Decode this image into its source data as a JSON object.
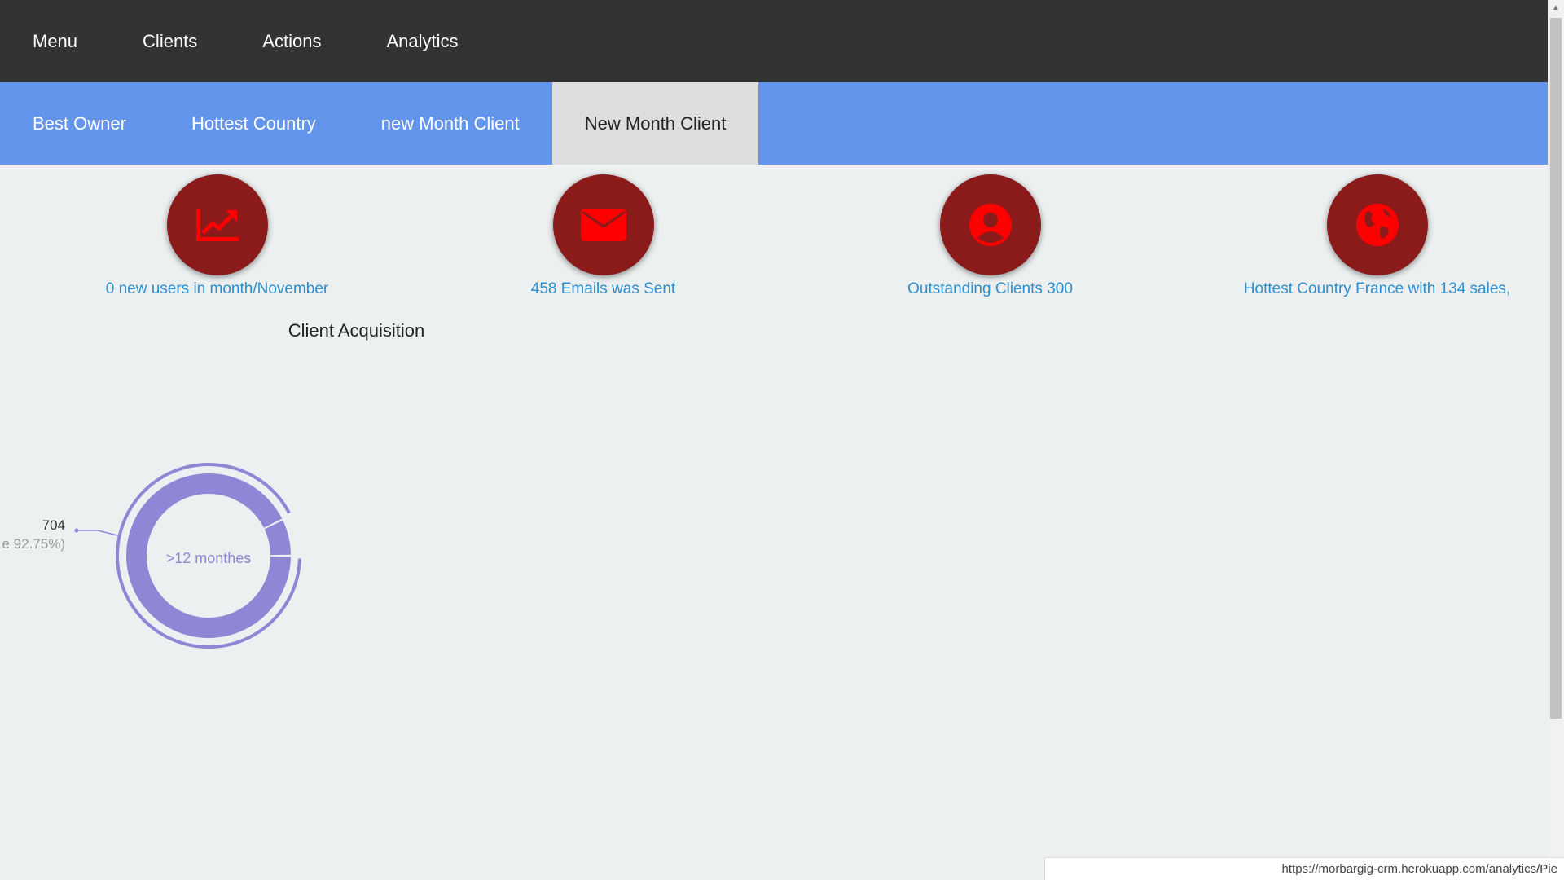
{
  "topnav": {
    "items": [
      {
        "label": "Menu"
      },
      {
        "label": "Clients"
      },
      {
        "label": "Actions"
      },
      {
        "label": "Analytics"
      }
    ]
  },
  "subnav": {
    "items": [
      {
        "label": "Best Owner"
      },
      {
        "label": "Hottest Country"
      },
      {
        "label": "new Month Client"
      },
      {
        "label": "New Month Client",
        "active": true
      }
    ]
  },
  "stats": [
    {
      "icon": "trending-up-icon",
      "caption": "0 new users in month/November"
    },
    {
      "icon": "envelope-icon",
      "caption": "458 Emails was Sent"
    },
    {
      "icon": "user-circle-icon",
      "caption": "Outstanding Clients 300"
    },
    {
      "icon": "globe-icon",
      "caption": "Hottest Country France with 134 sales,"
    }
  ],
  "colors": {
    "topnav_bg": "#333333",
    "subnav_bg": "#6495ed",
    "active_tab_bg": "#dddddd",
    "stat_circle": "#8b1a1a",
    "stat_icon": "#ff0000",
    "caption_text": "#2a8fd0",
    "donut": "#8f87d6"
  },
  "chart_data": {
    "type": "pie",
    "title": "Client Acquisition",
    "center_label": ">12 monthes",
    "slices": [
      {
        "value": 704,
        "label_line1": "704",
        "label_line2": "e 92.75%)",
        "percent": 92.75
      },
      {
        "value": 55,
        "percent": 7.25
      }
    ]
  },
  "statusbar": {
    "url": "https://morbargig-crm.herokuapp.com/analytics/Pie"
  }
}
